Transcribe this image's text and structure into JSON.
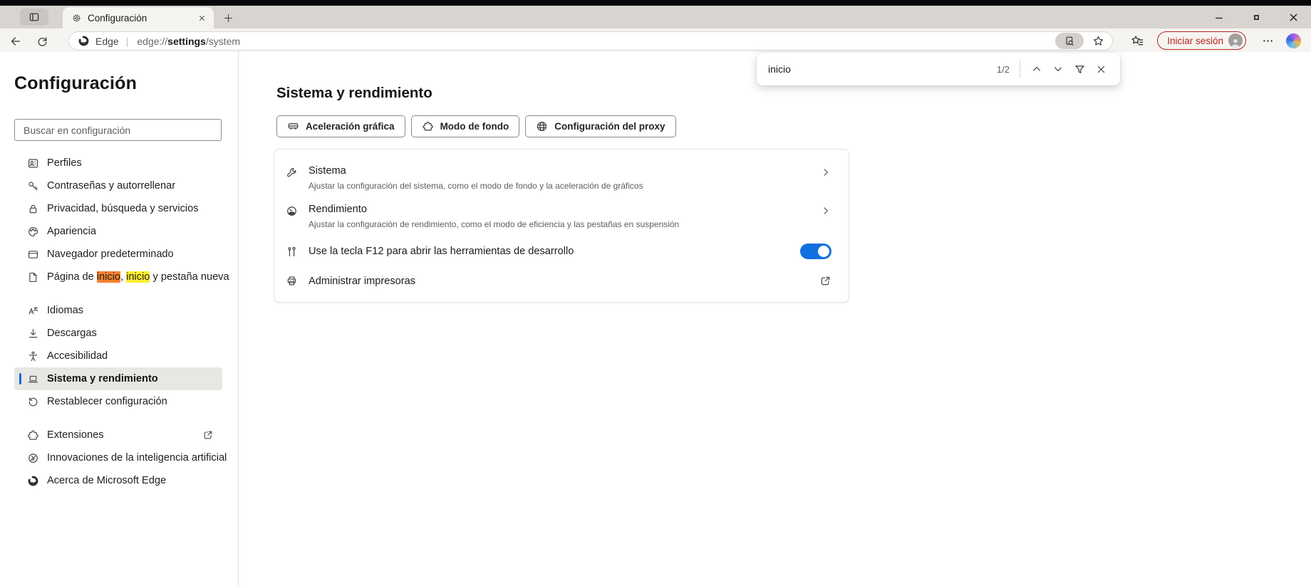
{
  "window_controls": {
    "minimize": "minimize",
    "maximize": "maximize",
    "close": "close"
  },
  "tab_strip": {
    "tab_title": "Configuración"
  },
  "toolbar": {
    "brand": "Edge",
    "url_prefix": "edge://",
    "url_emphasis": "settings",
    "url_suffix": "/system",
    "sign_in_label": "Iniciar sesión"
  },
  "find_bar": {
    "query": "inicio",
    "counter": "1/2"
  },
  "sidebar": {
    "title": "Configuración",
    "search_placeholder": "Buscar en configuración",
    "groups": [
      {
        "items": [
          {
            "id": "perfiles",
            "icon": "profiles-icon",
            "label": "Perfiles"
          },
          {
            "id": "contrasenas",
            "icon": "key-icon",
            "label": "Contraseñas y autorrellenar"
          },
          {
            "id": "privacidad",
            "icon": "lock-icon",
            "label": "Privacidad, búsqueda y servicios"
          },
          {
            "id": "apariencia",
            "icon": "palette-icon",
            "label": "Apariencia"
          },
          {
            "id": "navegador-predeterminado",
            "icon": "browser-window-icon",
            "label": "Navegador predeterminado"
          },
          {
            "id": "pagina-de-inicio",
            "icon": "page-icon",
            "label_parts": [
              {
                "text": "Página de "
              },
              {
                "text": "inicio",
                "highlight": "active"
              },
              {
                "text": ", "
              },
              {
                "text": "inicio",
                "highlight": "match"
              },
              {
                "text": " y pestaña nueva"
              }
            ]
          }
        ]
      },
      {
        "items": [
          {
            "id": "idiomas",
            "icon": "translate-icon",
            "label": "Idiomas"
          },
          {
            "id": "descargas",
            "icon": "download-icon",
            "label": "Descargas"
          },
          {
            "id": "accesibilidad",
            "icon": "accessibility-icon",
            "label": "Accesibilidad"
          },
          {
            "id": "sistema-y-rendimiento",
            "icon": "laptop-icon",
            "label": "Sistema y rendimiento",
            "selected": true
          },
          {
            "id": "restablecer",
            "icon": "reset-icon",
            "label": "Restablecer configuración"
          }
        ]
      },
      {
        "items": [
          {
            "id": "extensiones",
            "icon": "puzzle-icon",
            "label": "Extensiones",
            "external": true
          },
          {
            "id": "innovaciones-ia",
            "icon": "ai-icon",
            "label": "Innovaciones de la inteligencia artificial"
          },
          {
            "id": "acerca-de-edge",
            "icon": "edge-logo-icon",
            "label": "Acerca de Microsoft Edge"
          }
        ]
      }
    ]
  },
  "main": {
    "title": "Sistema y rendimiento",
    "action_buttons": [
      {
        "id": "aceleracion-grafica",
        "icon": "gpu-icon",
        "label": "Aceleración gráfica"
      },
      {
        "id": "modo-de-fondo",
        "icon": "bg-mode-icon",
        "label": "Modo de fondo"
      },
      {
        "id": "configuracion-proxy",
        "icon": "globe-icon",
        "label": "Configuración del proxy"
      }
    ],
    "card_rows": [
      {
        "id": "sistema",
        "icon": "wrench-icon",
        "title": "Sistema",
        "subtitle": "Ajustar la configuración del sistema, como el modo de fondo y la aceleración de gráficos",
        "trailing": "chevron"
      },
      {
        "id": "rendimiento",
        "icon": "gauge-icon",
        "title": "Rendimiento",
        "subtitle": "Ajustar la configuración de rendimiento, como el modo de eficiencia y las pestañas en suspensión",
        "trailing": "chevron"
      },
      {
        "id": "tecla-f12",
        "icon": "devtools-icon",
        "title": "Use la tecla F12 para abrir las herramientas de desarrollo",
        "trailing": "toggle",
        "toggle_on": true
      },
      {
        "id": "administrar-impresoras",
        "icon": "printer-icon",
        "title": "Administrar impresoras",
        "trailing": "external"
      }
    ]
  },
  "colors": {
    "accent_blue": "#1070e0",
    "selected_accent": "#0b68d6",
    "find_highlight_active": "#f5812e",
    "find_highlight_match": "#fdee2e",
    "sign_in_red": "#b8231f",
    "tab_strip_bg": "#d8d4cf",
    "toolbar_bg": "#f6f4f1"
  }
}
